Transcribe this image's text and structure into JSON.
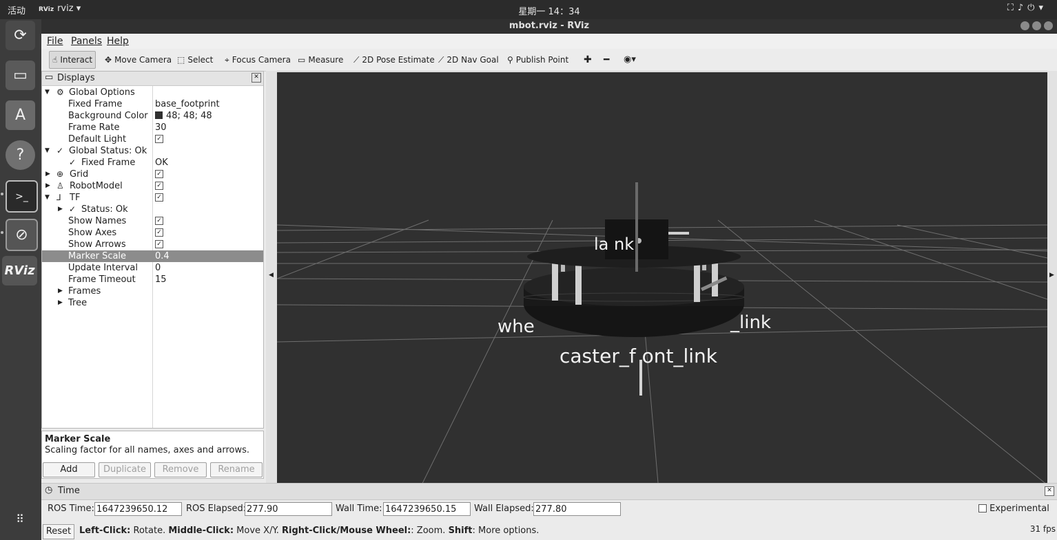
{
  "topbar": {
    "activities": "活动",
    "app_icon": "RViz",
    "app_name": "rviz",
    "app_menu_arrow": "▾",
    "clock": "星期一 14：34",
    "tray_icons": [
      "network-icon",
      "volume-icon",
      "power-icon",
      "chevron-down-icon"
    ]
  },
  "launcher": {
    "items": [
      "updater-icon",
      "files-icon",
      "software-icon",
      "help-icon",
      "terminal-icon",
      "disk-icon",
      "rviz-icon"
    ],
    "rviz_label": "RViz"
  },
  "window": {
    "title": "mbot.rviz - RViz"
  },
  "menubar": {
    "file": "File",
    "panels": "Panels",
    "help": "Help"
  },
  "toolbar": {
    "interact": "Interact",
    "move_camera": "Move Camera",
    "select": "Select",
    "focus_camera": "Focus Camera",
    "measure": "Measure",
    "pose_estimate": "2D Pose Estimate",
    "nav_goal": "2D Nav Goal",
    "publish_point": "Publish Point"
  },
  "displays": {
    "title": "Displays",
    "rows": [
      {
        "label": "Global Options",
        "value": ""
      },
      {
        "label": "Fixed Frame",
        "value": "base_footprint"
      },
      {
        "label": "Background Color",
        "value": "48; 48; 48"
      },
      {
        "label": "Frame Rate",
        "value": "30"
      },
      {
        "label": "Default Light",
        "value": ""
      },
      {
        "label": "Global Status: Ok",
        "value": ""
      },
      {
        "label": "Fixed Frame",
        "value": "OK"
      },
      {
        "label": "Grid",
        "value": ""
      },
      {
        "label": "RobotModel",
        "value": ""
      },
      {
        "label": "TF",
        "value": ""
      },
      {
        "label": "Status: Ok",
        "value": ""
      },
      {
        "label": "Show Names",
        "value": ""
      },
      {
        "label": "Show Axes",
        "value": ""
      },
      {
        "label": "Show Arrows",
        "value": ""
      },
      {
        "label": "Marker Scale",
        "value": "0.4"
      },
      {
        "label": "Update Interval",
        "value": "0"
      },
      {
        "label": "Frame Timeout",
        "value": "15"
      },
      {
        "label": "Frames",
        "value": ""
      },
      {
        "label": "Tree",
        "value": ""
      }
    ],
    "checkbox_mark": "✓",
    "background_color_hex": "#303030"
  },
  "description": {
    "title": "Marker Scale",
    "text": "Scaling factor for all names, axes and arrows."
  },
  "buttons": {
    "add": "Add",
    "duplicate": "Duplicate",
    "remove": "Remove",
    "rename": "Rename"
  },
  "viewport": {
    "labels": {
      "top": "la        nk",
      "wheel_left": "whe",
      "wheel_right": "_link",
      "caster": "caster_f ont_link"
    }
  },
  "time": {
    "title": "Time",
    "ros_time_label": "ROS Time:",
    "ros_time": "1647239650.12",
    "ros_elapsed_label": "ROS Elapsed:",
    "ros_elapsed": "277.90",
    "wall_time_label": "Wall Time:",
    "wall_time": "1647239650.15",
    "wall_elapsed_label": "Wall Elapsed:",
    "wall_elapsed": "277.80",
    "experimental": "Experimental"
  },
  "status": {
    "reset": "Reset",
    "k1": "Left-Click:",
    "v1": " Rotate. ",
    "k2": "Middle-Click:",
    "v2": " Move X/Y. ",
    "k3": "Right-Click/Mouse Wheel:",
    "v3": ": Zoom. ",
    "k4": "Shift",
    "v4": ": More options.",
    "fps": "31 fps"
  }
}
